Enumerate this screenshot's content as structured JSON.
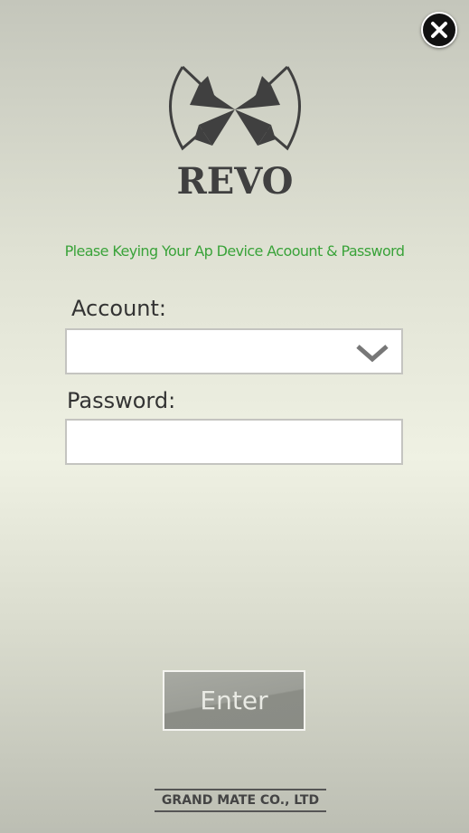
{
  "logo": {
    "text": "REVO"
  },
  "prompt": "Please Keying Your Ap Device Acoount & Password",
  "account": {
    "label": "Account:",
    "value": "",
    "icon": "chevron-down-icon"
  },
  "password": {
    "label": "Password:",
    "value": ""
  },
  "enter_label": "Enter",
  "footer": "GRAND MATE CO., LTD",
  "colors": {
    "prompt": "#3aa33a",
    "logo": "#404040"
  }
}
